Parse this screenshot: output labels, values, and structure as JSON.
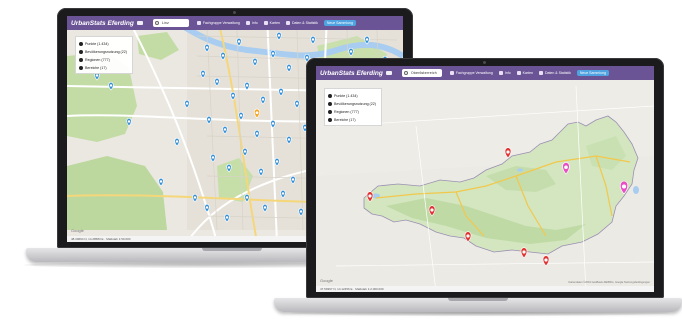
{
  "app": {
    "brand_back": "UrbanStats Eferding",
    "brand_front": "UrbanStats Eferding",
    "search_value_back": "Linz",
    "search_value_front": "Oberösterreich",
    "menu": [
      {
        "label": "Fachgruppe Verwaltung",
        "icon": "users-icon"
      },
      {
        "label": "Info",
        "icon": "info-icon"
      },
      {
        "label": "Karten",
        "icon": "map-icon"
      },
      {
        "label": "Daten & Statistik",
        "icon": "chart-icon"
      }
    ],
    "record_button": "Neue Sammlung"
  },
  "legend": {
    "items": [
      {
        "label": "Punkte (1.434)"
      },
      {
        "label": "Bevölkerungsnutzung (22)"
      },
      {
        "label": "Regionen (777)"
      },
      {
        "label": "Bereiche (17)"
      }
    ]
  },
  "map_back": {
    "google": "Google",
    "coords": "48.30694 N, 14.28583 E · Maßstab 1:50.000"
  },
  "map_front": {
    "google": "Google",
    "coords": "47.59397 N, 14.12456 E · Maßstab 1:2.000.000",
    "attribution": "Kartendaten ©2019 GeoBasis-DE/BKG, Google  Nutzungsbedingungen"
  },
  "colors": {
    "topbar": "#6a5496",
    "pin_blue": "#2f8fd8",
    "pin_red": "#e03434",
    "pin_pink": "#e84fc4",
    "pin_orange": "#f5a623",
    "park_green": "#b9d79a",
    "land": "#e9e6df"
  }
}
